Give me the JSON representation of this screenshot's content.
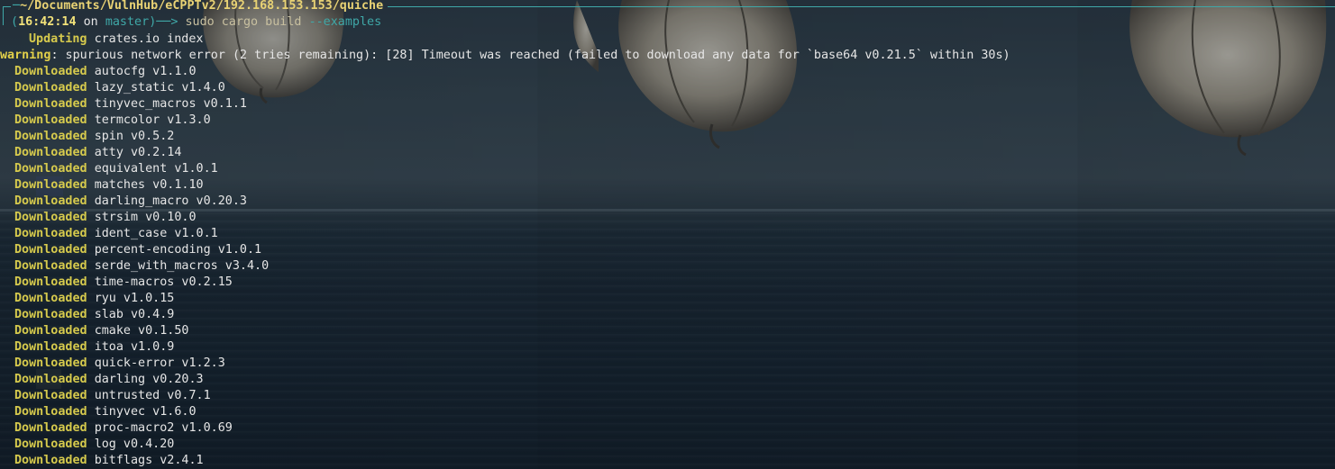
{
  "prompt": {
    "path": "~/Documents/VulnHub/eCPPTv2/192.168.153.153/quiche",
    "time": "16:42:14",
    "on_word": "on",
    "branch": "master",
    "arrow": "──>",
    "command": "sudo cargo build",
    "command_arg": "--examples"
  },
  "updating": {
    "status": "Updating",
    "text": "crates.io index"
  },
  "warning": {
    "label": "warning",
    "text": ": spurious network error (2 tries remaining): [28] Timeout was reached (failed to download any data for `base64 v0.21.5` within 30s)"
  },
  "download_status": "Downloaded",
  "downloads": [
    "autocfg v1.1.0",
    "lazy_static v1.4.0",
    "tinyvec_macros v0.1.1",
    "termcolor v1.3.0",
    "spin v0.5.2",
    "atty v0.2.14",
    "equivalent v1.0.1",
    "matches v0.1.10",
    "darling_macro v0.20.3",
    "strsim v0.10.0",
    "ident_case v1.0.1",
    "percent-encoding v1.0.1",
    "serde_with_macros v3.4.0",
    "time-macros v0.2.15",
    "ryu v1.0.15",
    "slab v0.4.9",
    "cmake v0.1.50",
    "itoa v1.0.9",
    "quick-error v1.2.3",
    "darling v0.20.3",
    "untrusted v0.7.1",
    "tinyvec v1.6.0",
    "proc-macro2 v1.0.69",
    "log v0.4.20",
    "bitflags v2.4.1"
  ],
  "colors": {
    "accent_teal": "#3fa8a8",
    "status_yellow": "#d6ca4d",
    "path_yellow": "#e8d274",
    "text": "#e6e6e6",
    "background": "#1d2a36"
  }
}
